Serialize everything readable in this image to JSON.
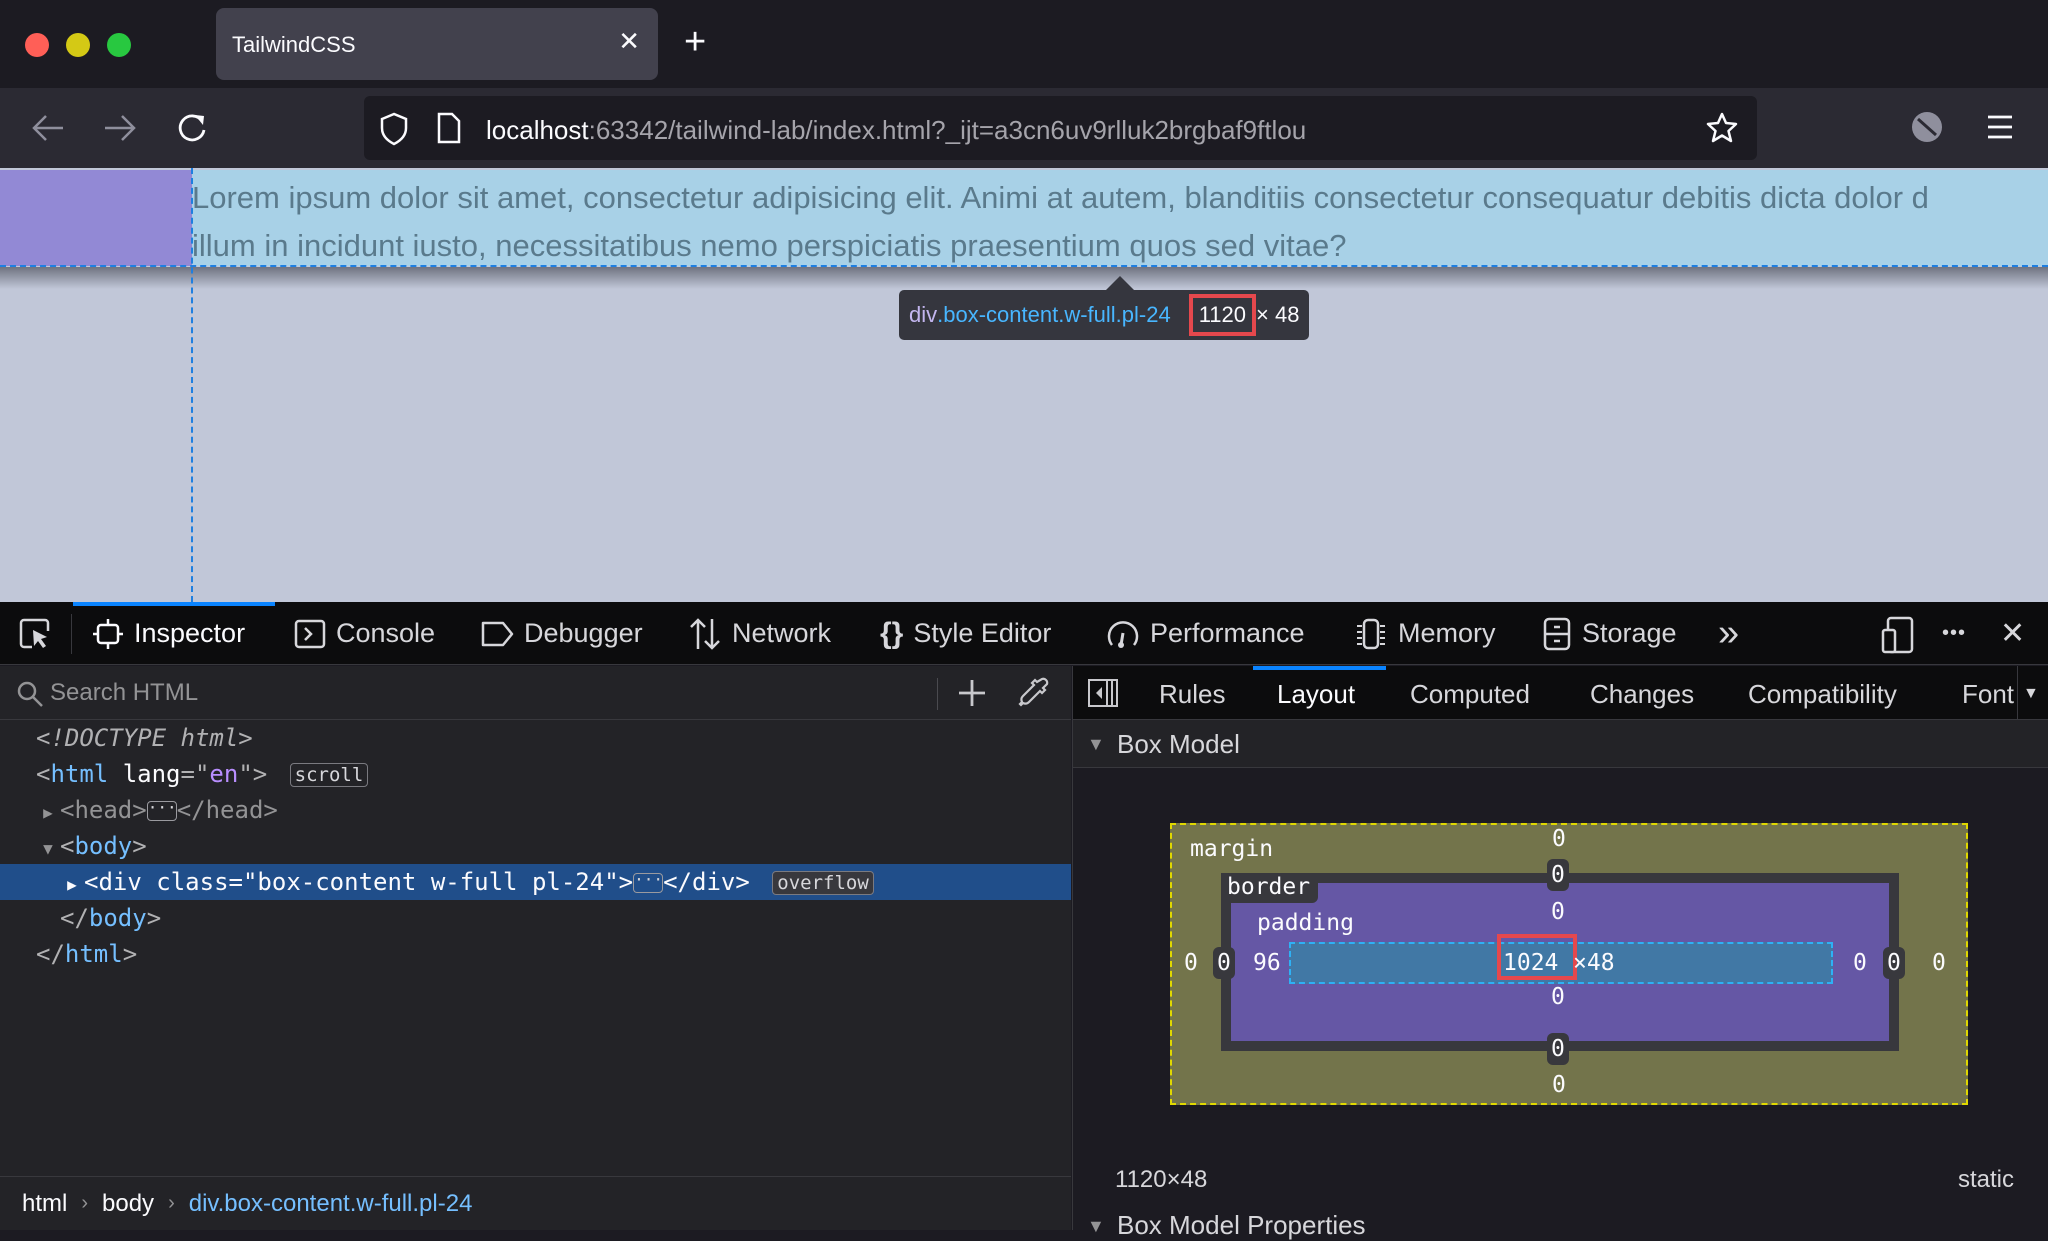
{
  "browser": {
    "tab_title": "TailwindCSS",
    "tab_close_glyph": "✕",
    "new_tab_glyph": "+",
    "url_host": "localhost",
    "url_rest": ":63342/tailwind-lab/index.html?_ijt=a3cn6uv9rlluk2brgbaf9ftlou",
    "traffic_lights": {
      "close": "#ff5f57",
      "minimize": "#febc2e",
      "maximize": "#28c840"
    }
  },
  "page": {
    "lorem_line1": "Lorem ipsum dolor sit amet, consectetur adipisicing elit. Animi at autem, blanditiis consectetur consequatur debitis dicta dolor d",
    "lorem_line2": "illum in incidunt iusto, necessitatibus nemo perspiciatis praesentium quos sed vitae?",
    "infobar": {
      "tag": "div",
      "classes": ".box-content.w-full.pl-24",
      "width": "1120",
      "times": "× 48"
    }
  },
  "devtools": {
    "tools": [
      {
        "label": "Inspector",
        "icon": "inspector-icon",
        "active": true
      },
      {
        "label": "Console",
        "icon": "console-icon"
      },
      {
        "label": "Debugger",
        "icon": "debugger-icon"
      },
      {
        "label": "Network",
        "icon": "network-icon"
      },
      {
        "label": "Style Editor",
        "icon": "style-editor-icon"
      },
      {
        "label": "Performance",
        "icon": "performance-icon"
      },
      {
        "label": "Memory",
        "icon": "memory-icon"
      },
      {
        "label": "Storage",
        "icon": "storage-icon"
      }
    ],
    "more_tools_glyph": "»",
    "meatball_glyph": "•••",
    "close_glyph": "✕",
    "search_placeholder": "Search HTML",
    "search_value": "",
    "tree": {
      "doctype": "<!DOCTYPE html>",
      "html_open_tag": "html",
      "html_attr": "lang",
      "html_attr_val": "en",
      "scroll_badge": "scroll",
      "head_tag": "head",
      "body_tag": "body",
      "div_tag": "div",
      "div_attr": "class",
      "div_attr_val": "box-content w-full pl-24",
      "overflow_badge": "overflow",
      "ellipsis": "···"
    },
    "breadcrumbs": [
      "html",
      "body",
      "div.box-content.w-full.pl-24"
    ],
    "side_tabs": [
      "Rules",
      "Layout",
      "Computed",
      "Changes",
      "Compatibility",
      "Font"
    ],
    "active_side_tab": "Layout",
    "box_model": {
      "header": "Box Model",
      "labels": {
        "margin": "margin",
        "border": "border",
        "padding": "padding"
      },
      "margin": {
        "top": "0",
        "right": "0",
        "bottom": "0",
        "left": "0"
      },
      "border": {
        "top": "0",
        "right": "0",
        "bottom": "0",
        "left": "0"
      },
      "padding": {
        "top": "0",
        "right": "0",
        "bottom": "0",
        "left": "96"
      },
      "content_width": "1024",
      "content_height_part": "×48",
      "element_size": "1120×48",
      "position": "static",
      "properties_header": "Box Model Properties"
    }
  }
}
